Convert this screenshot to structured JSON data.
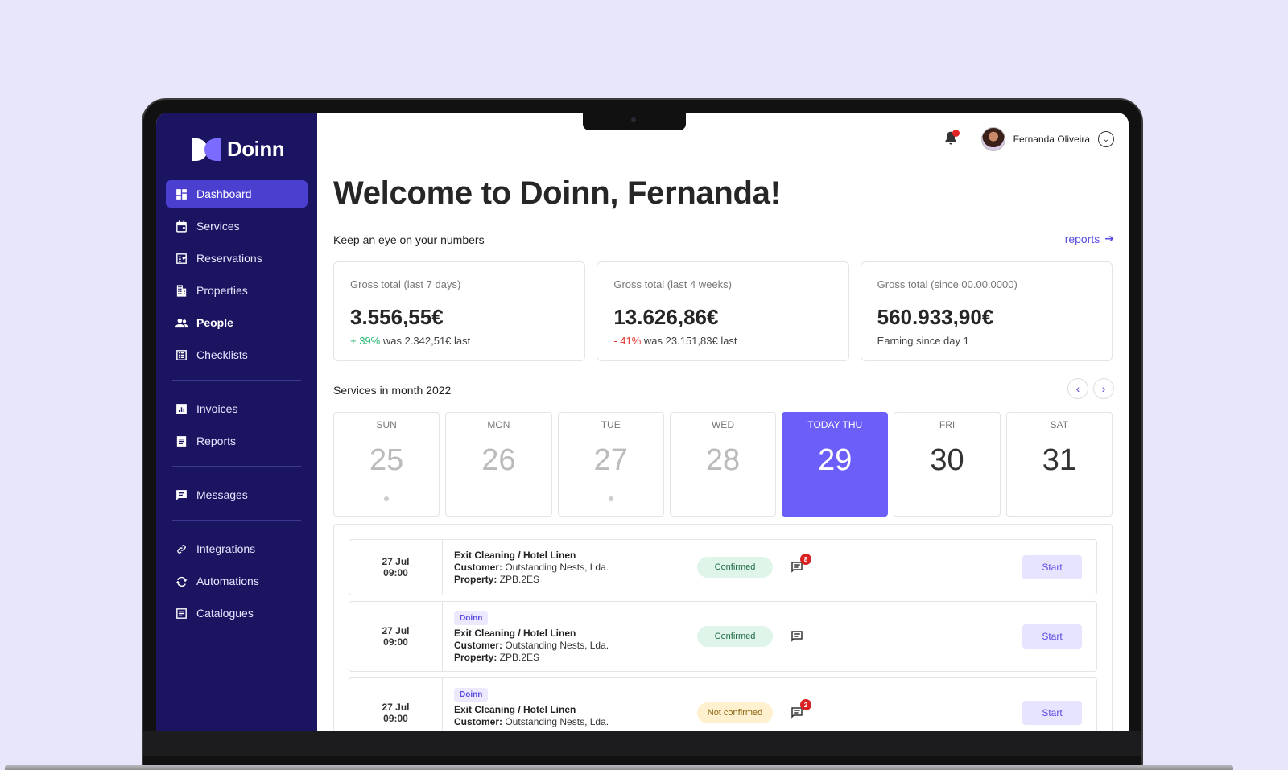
{
  "brand": {
    "name": "Doinn"
  },
  "sidebar": {
    "items": [
      {
        "label": "Dashboard",
        "icon": "dashboard-icon"
      },
      {
        "label": "Services",
        "icon": "calendar-icon"
      },
      {
        "label": "Reservations",
        "icon": "reservation-icon"
      },
      {
        "label": "Properties",
        "icon": "building-icon"
      },
      {
        "label": "People",
        "icon": "people-icon"
      },
      {
        "label": "Checklists",
        "icon": "checklist-icon"
      },
      {
        "label": "Invoices",
        "icon": "invoice-icon"
      },
      {
        "label": "Reports",
        "icon": "report-icon"
      },
      {
        "label": "Messages",
        "icon": "message-icon"
      },
      {
        "label": "Integrations",
        "icon": "link-icon"
      },
      {
        "label": "Automations",
        "icon": "sync-icon"
      },
      {
        "label": "Catalogues",
        "icon": "catalogue-icon"
      }
    ]
  },
  "header": {
    "user_name": "Fernanda Oliveira"
  },
  "main": {
    "welcome": "Welcome to Doinn, Fernanda!",
    "numbers_heading": "Keep an eye on your numbers",
    "reports_link": "reports",
    "cards": [
      {
        "label": "Gross total (last 7 days)",
        "value": "3.556,55€",
        "delta": "+ 39%",
        "note": " was 2.342,51€ last"
      },
      {
        "label": "Gross total (last 4 weeks)",
        "value": "13.626,86€",
        "delta": "- 41%",
        "note": " was 23.151,83€ last"
      },
      {
        "label": "Gross total (since 00.00.0000)",
        "value": "560.933,90€",
        "note": "Earning since day 1"
      }
    ],
    "services_heading": "Services in month 2022",
    "week": [
      {
        "name": "SUN",
        "date": "25"
      },
      {
        "name": "MON",
        "date": "26"
      },
      {
        "name": "TUE",
        "date": "27"
      },
      {
        "name": "WED",
        "date": "28"
      },
      {
        "name": "TODAY THU",
        "date": "29"
      },
      {
        "name": "FRI",
        "date": "30"
      },
      {
        "name": "SAT",
        "date": "31"
      }
    ],
    "services": [
      {
        "day": "27 Jul",
        "time": "09:00",
        "tag": "",
        "title": "Exit Cleaning / Hotel Linen",
        "customer_label": "Customer:",
        "customer": " Outstanding Nests, Lda.",
        "property_label": "Property:",
        "property": " ZPB.2ES",
        "status": "Confirmed",
        "messages": "8",
        "action": "Start"
      },
      {
        "day": "27 Jul",
        "time": "09:00",
        "tag": "Doinn",
        "title": "Exit Cleaning / Hotel Linen",
        "customer_label": "Customer:",
        "customer": " Outstanding Nests, Lda.",
        "property_label": "Property:",
        "property": " ZPB.2ES",
        "status": "Confirmed",
        "messages": "",
        "action": "Start"
      },
      {
        "day": "27 Jul",
        "time": "09:00",
        "tag": "Doinn",
        "title": "Exit Cleaning / Hotel Linen",
        "customer_label": "Customer:",
        "customer": " Outstanding Nests, Lda.",
        "property_label": "",
        "property": "",
        "status": "Not confirmed",
        "messages": "2",
        "action": "Start"
      }
    ]
  },
  "colors": {
    "sidebar": "#1a1461",
    "accent": "#6c5ef8",
    "active": "#4b3fd0",
    "background": "#e8e6fb"
  }
}
